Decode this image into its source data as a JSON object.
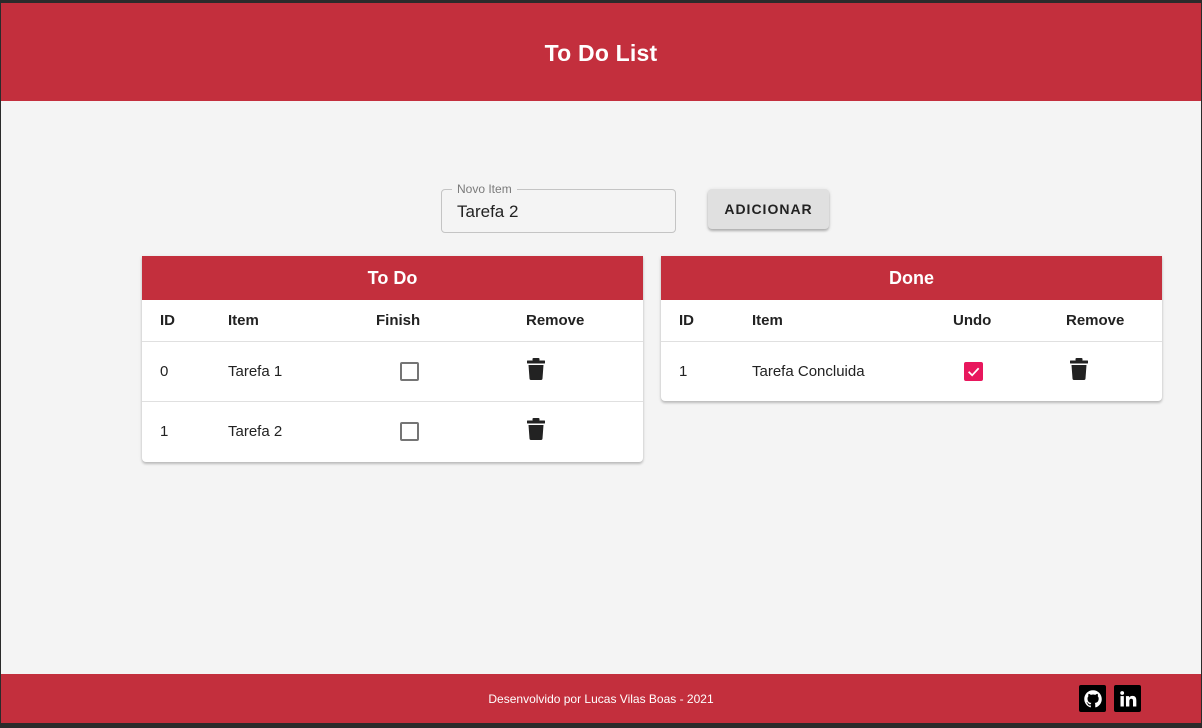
{
  "header": {
    "title": "To Do List"
  },
  "form": {
    "input_label": "Novo Item",
    "input_value": "Tarefa 2",
    "add_button": "ADICIONAR"
  },
  "todo": {
    "title": "To Do",
    "columns": [
      "ID",
      "Item",
      "Finish",
      "Remove"
    ],
    "rows": [
      {
        "id": "0",
        "item": "Tarefa 1",
        "checked": false
      },
      {
        "id": "1",
        "item": "Tarefa 2",
        "checked": false
      }
    ]
  },
  "done": {
    "title": "Done",
    "columns": [
      "ID",
      "Item",
      "Undo",
      "Remove"
    ],
    "rows": [
      {
        "id": "1",
        "item": "Tarefa Concluida",
        "checked": true
      }
    ]
  },
  "footer": {
    "text": "Desenvolvido por Lucas Vilas Boas - 2021",
    "icons": [
      "github-icon",
      "linkedin-icon"
    ]
  },
  "colors": {
    "brand_red": "#c32f3d",
    "checkbox_pink": "#e8175d",
    "background": "#f4f4f4"
  }
}
